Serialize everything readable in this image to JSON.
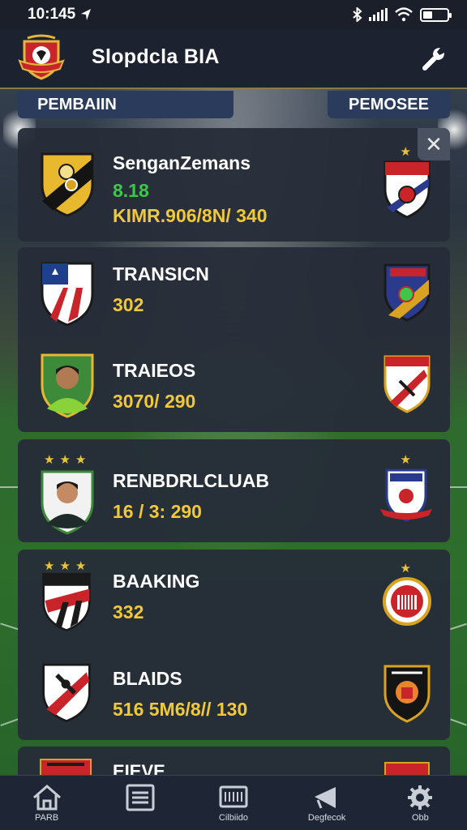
{
  "status_bar": {
    "time": "10:145"
  },
  "header": {
    "title": "Slopdcla BIA"
  },
  "tabs": {
    "left": "PEMBAIIN",
    "right": "PEMOSEE"
  },
  "matches": [
    {
      "team": "SenganZemans",
      "score_primary": "8.18",
      "score_secondary": "KIMR.906/8N/ 340",
      "left_stars": 0,
      "right_stars": 1
    },
    {
      "team": "TRANSICN",
      "score_primary": "302",
      "left_stars": 0,
      "right_stars": 0
    },
    {
      "team": "TRAIEOS",
      "score_primary": "3070/ 290",
      "left_stars": 0,
      "right_stars": 0
    },
    {
      "team": "RENBDRLCLUAB",
      "score_primary": "16 / 3: 290",
      "left_stars": 3,
      "right_stars": 1
    },
    {
      "team": "BAAKING",
      "score_primary": "332",
      "left_stars": 3,
      "right_stars": 1
    },
    {
      "team": "BLAIDS",
      "score_primary": "516 5M6/8// 130",
      "left_stars": 0,
      "right_stars": 0
    },
    {
      "team": "EIEVE",
      "left_stars": 0,
      "right_stars": 0
    }
  ],
  "close_icon_glyph": "✕",
  "nav": [
    {
      "label": "PARB",
      "icon": "home-icon"
    },
    {
      "label": "",
      "icon": "list-icon"
    },
    {
      "label": "Cilbiido",
      "icon": "scoreboard-icon"
    },
    {
      "label": "Degfecok",
      "icon": "megaphone-icon"
    },
    {
      "label": "Obb",
      "icon": "settings-icon"
    }
  ],
  "colors": {
    "accent_yellow": "#f0c93a",
    "accent_green": "#3ec64a",
    "card_bg": "#262c38",
    "tab_bg": "#2a3b5c",
    "nav_bg": "#1e2635"
  }
}
